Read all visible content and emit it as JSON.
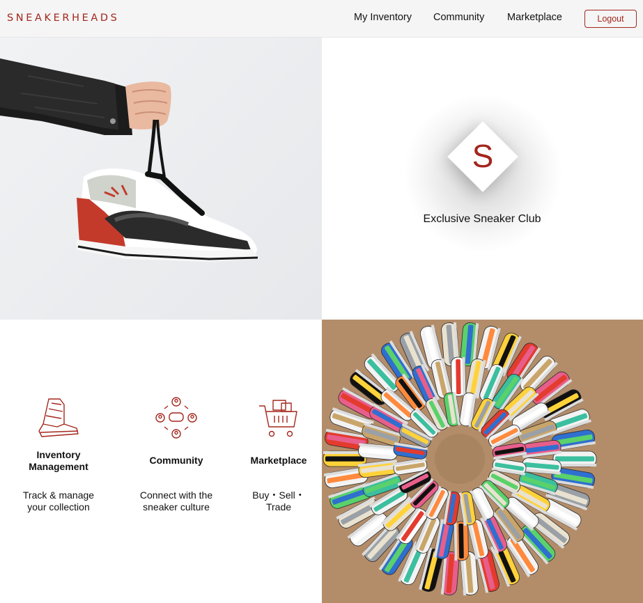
{
  "header": {
    "brand": "SNEAKERHEADS",
    "nav": [
      "My Inventory",
      "Community",
      "Marketplace"
    ],
    "logout_label": "Logout"
  },
  "club": {
    "logo_letter": "S",
    "caption": "Exclusive Sneaker Club"
  },
  "features": [
    {
      "icon": "sneaker-icon",
      "title": "Inventory Management",
      "desc": "Track & manage your collection"
    },
    {
      "icon": "community-icon",
      "title": "Community",
      "desc": "Connect with the sneaker culture"
    },
    {
      "icon": "cart-icon",
      "title": "Marketplace",
      "desc": "Buy・Sell・Trade"
    }
  ],
  "colors": {
    "accent": "#a3261d",
    "header_bg": "#f5f5f5",
    "cardboard": "#b38d69"
  }
}
